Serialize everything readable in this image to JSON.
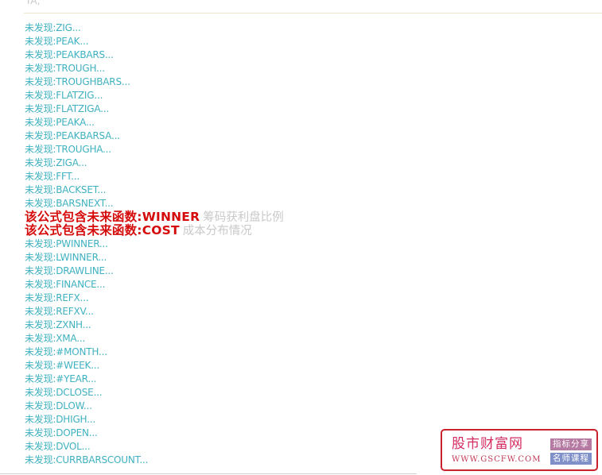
{
  "header": {
    "fragment": "TA;"
  },
  "results": [
    {
      "kind": "info",
      "text": "未发现:ZIG..."
    },
    {
      "kind": "info",
      "text": "未发现:PEAK..."
    },
    {
      "kind": "info",
      "text": "未发现:PEAKBARS..."
    },
    {
      "kind": "info",
      "text": "未发现:TROUGH..."
    },
    {
      "kind": "info",
      "text": "未发现:TROUGHBARS..."
    },
    {
      "kind": "info",
      "text": "未发现:FLATZIG..."
    },
    {
      "kind": "info",
      "text": "未发现:FLATZIGA..."
    },
    {
      "kind": "info",
      "text": "未发现:PEAKA..."
    },
    {
      "kind": "info",
      "text": "未发现:PEAKBARSA..."
    },
    {
      "kind": "info",
      "text": "未发现:TROUGHA..."
    },
    {
      "kind": "info",
      "text": "未发现:ZIGA..."
    },
    {
      "kind": "info",
      "text": "未发现:FFT..."
    },
    {
      "kind": "info",
      "text": "未发现:BACKSET..."
    },
    {
      "kind": "info",
      "text": "未发现:BARSNEXT..."
    },
    {
      "kind": "warn",
      "text": "该公式包含未来函数:WINNER",
      "desc": "筹码获利盘比例"
    },
    {
      "kind": "warn",
      "text": "该公式包含未来函数:COST",
      "desc": "成本分布情况"
    },
    {
      "kind": "info",
      "text": "未发现:PWINNER..."
    },
    {
      "kind": "info",
      "text": "未发现:LWINNER..."
    },
    {
      "kind": "info",
      "text": "未发现:DRAWLINE..."
    },
    {
      "kind": "info",
      "text": "未发现:FINANCE..."
    },
    {
      "kind": "info",
      "text": "未发现:REFX..."
    },
    {
      "kind": "info",
      "text": "未发现:REFXV..."
    },
    {
      "kind": "info",
      "text": "未发现:ZXNH..."
    },
    {
      "kind": "info",
      "text": "未发现:XMA..."
    },
    {
      "kind": "info",
      "text": "未发现:#MONTH..."
    },
    {
      "kind": "info",
      "text": "未发现:#WEEK..."
    },
    {
      "kind": "info",
      "text": "未发现:#YEAR..."
    },
    {
      "kind": "info",
      "text": "未发现:DCLOSE..."
    },
    {
      "kind": "info",
      "text": "未发现:DLOW..."
    },
    {
      "kind": "info",
      "text": "未发现:DHIGH..."
    },
    {
      "kind": "info",
      "text": "未发现:DOPEN..."
    },
    {
      "kind": "info",
      "text": "未发现:DVOL..."
    },
    {
      "kind": "info",
      "text": "未发现:CURRBARSCOUNT..."
    }
  ],
  "watermark": {
    "title": "股市财富网",
    "url": "WWW.GSCFW.COM",
    "tag_top": "指标分享",
    "tag_bottom": "名师课程"
  },
  "colors": {
    "info_text": "#3fb1c1",
    "warning_text": "#d50b0b",
    "description_text": "#c9c9c9",
    "watermark_border": "#c8232c"
  }
}
